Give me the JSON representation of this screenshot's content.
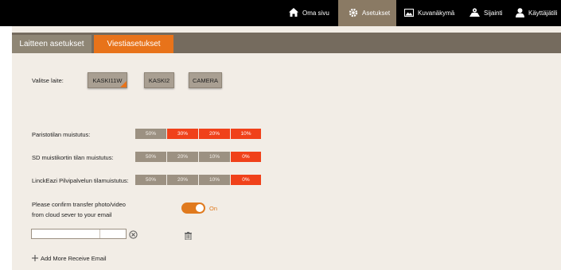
{
  "nav": {
    "items": [
      {
        "label": "Oma sivu",
        "icon": "home-icon"
      },
      {
        "label": "Asetukset",
        "icon": "gear-icon",
        "active": true
      },
      {
        "label": "Kuvanäkymä",
        "icon": "image-icon"
      },
      {
        "label": "Sijainti",
        "icon": "location-icon"
      },
      {
        "label": "Käyttäjätili",
        "icon": "user-icon"
      }
    ]
  },
  "tabs": [
    {
      "label": "Laitteen asetukset",
      "active": false
    },
    {
      "label": "Viestiasetukset",
      "active": true
    }
  ],
  "device": {
    "label": "Valitse laite:",
    "options": [
      "KASKI11W",
      "KASKI2",
      "CAMERA"
    ],
    "selected": "KASKI11W"
  },
  "reminders": [
    {
      "label": "Paristotilan muistutus:",
      "options": [
        "50%",
        "30%",
        "20%",
        "10%"
      ],
      "active": [
        false,
        true,
        true,
        true
      ]
    },
    {
      "label": "SD muistikortin tilan muistutus:",
      "options": [
        "50%",
        "20%",
        "10%",
        "0%"
      ],
      "active": [
        false,
        false,
        false,
        true
      ]
    },
    {
      "label": "LinckEazi Pilvipalvelun tilamuistutus:",
      "options": [
        "50%",
        "20%",
        "10%",
        "0%"
      ],
      "active": [
        false,
        false,
        false,
        true
      ]
    }
  ],
  "transfer": {
    "line1": "Please confirm transfer photo/video",
    "line2": "from cloud sever to your email",
    "toggle_state": "On",
    "enabled": true
  },
  "email": {
    "value": "",
    "add_more_label": "Add More Receive Email"
  },
  "colors": {
    "accent": "#e8731a",
    "active_segment": "#f0411a",
    "inactive_segment": "#9c9182"
  }
}
